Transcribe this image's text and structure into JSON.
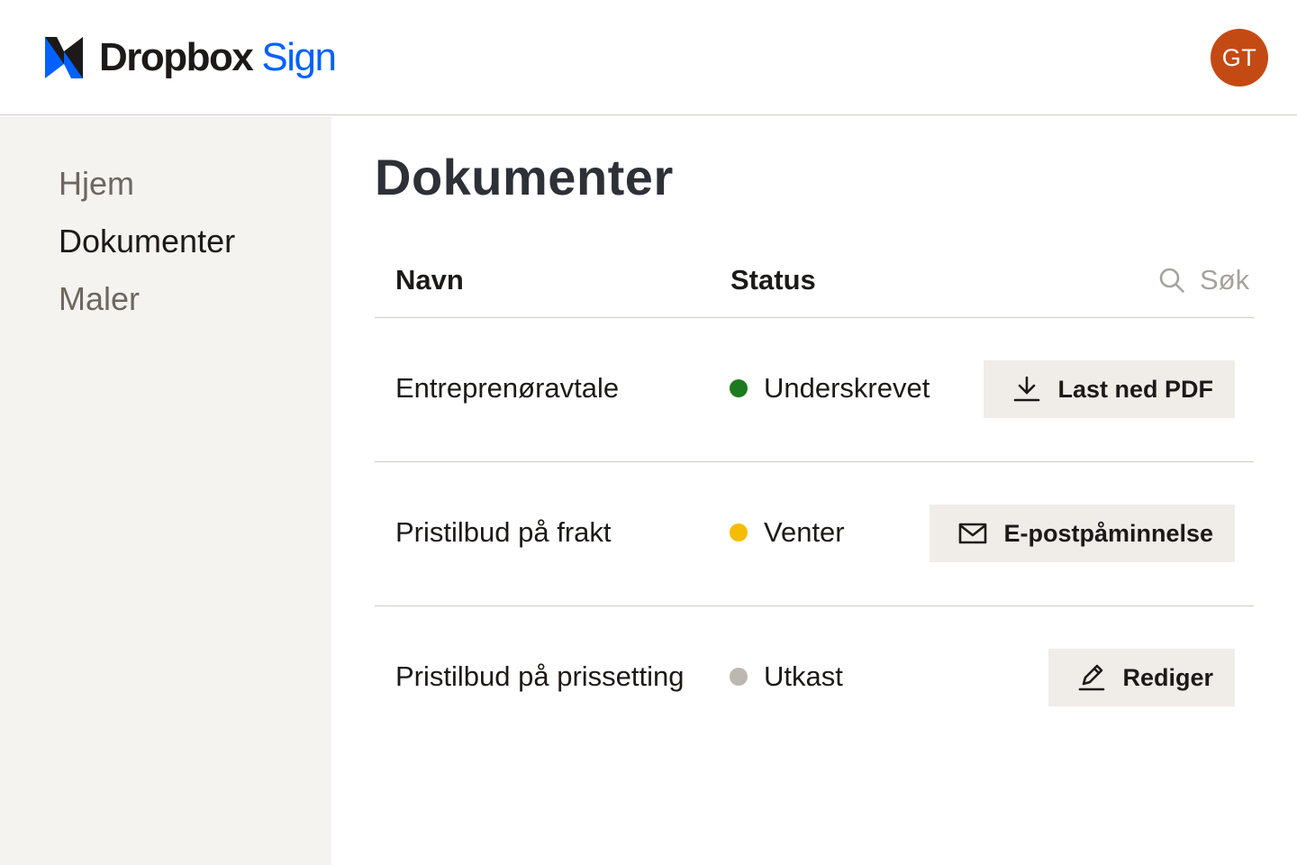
{
  "app": {
    "brand_word_1": "Dropbox",
    "brand_word_2": "Sign",
    "brand_color": "#0061fe",
    "logo_icon": "dropbox-sign-logo-icon"
  },
  "header": {
    "avatar_initials": "GT",
    "avatar_color": "#c44a14"
  },
  "sidebar": {
    "items": [
      {
        "label": "Hjem",
        "active": false
      },
      {
        "label": "Dokumenter",
        "active": true
      },
      {
        "label": "Maler",
        "active": false
      }
    ]
  },
  "main": {
    "title": "Dokumenter",
    "table": {
      "headers": {
        "name": "Navn",
        "status": "Status"
      },
      "search": {
        "placeholder": "Søk",
        "icon": "search-icon"
      },
      "rows": [
        {
          "name": "Entreprenøravtale",
          "status": "Underskrevet",
          "status_color": "#1e7a1e",
          "action": {
            "label": "Last ned PDF",
            "icon": "download-icon"
          }
        },
        {
          "name": "Pristilbud på frakt",
          "status": "Venter",
          "status_color": "#f5bc00",
          "action": {
            "label": "E-postpåminnelse",
            "icon": "envelope-icon"
          }
        },
        {
          "name": "Pristilbud på prissetting",
          "status": "Utkast",
          "status_color": "#bcb7b0",
          "action": {
            "label": "Rediger",
            "icon": "pencil-icon"
          }
        }
      ]
    }
  }
}
